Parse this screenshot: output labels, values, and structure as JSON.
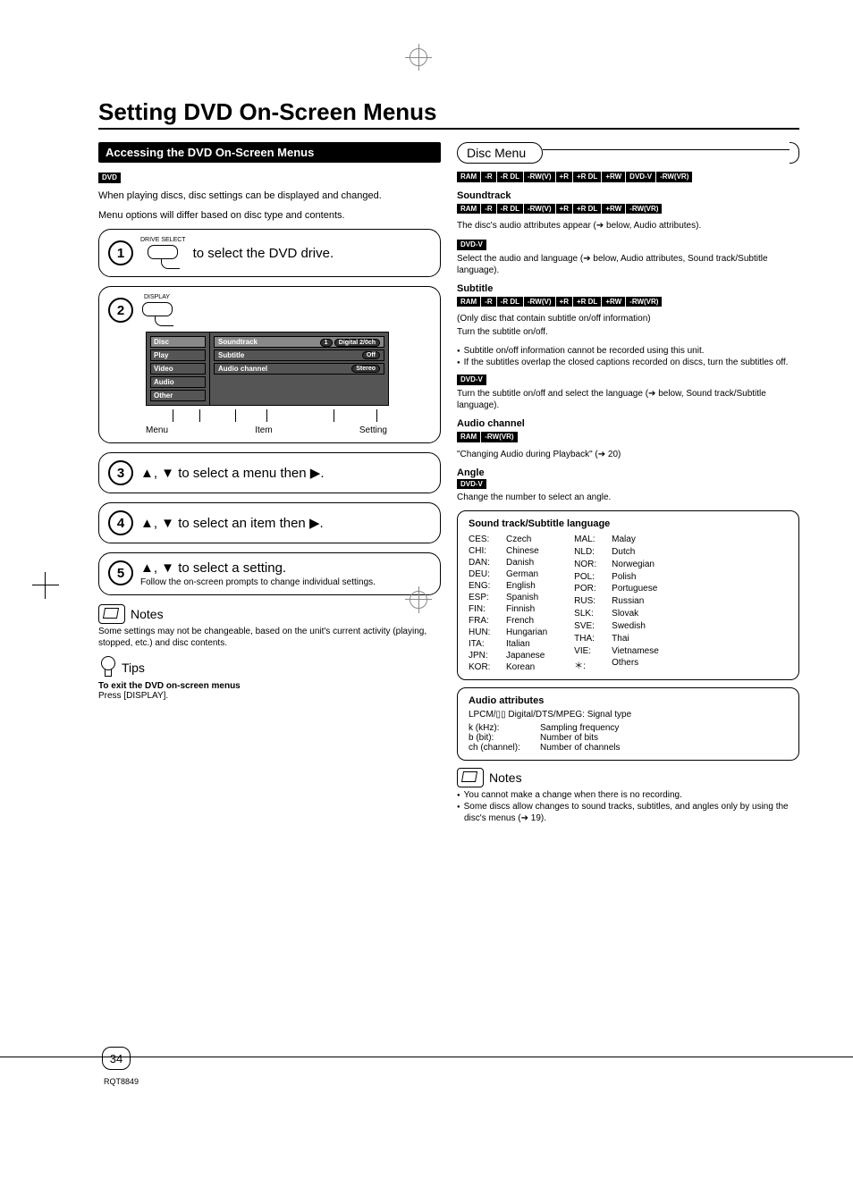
{
  "title": "Setting DVD On-Screen Menus",
  "page_number": "34",
  "doc_code": "RQT8849",
  "left": {
    "heading": "Accessing the DVD On-Screen Menus",
    "dvd_tag": "DVD",
    "intro1": "When playing discs, disc settings can be displayed and changed.",
    "intro2": "Menu options will differ based on disc type and contents.",
    "step1": {
      "btn": "DRIVE SELECT",
      "text": "to select the DVD drive."
    },
    "step2": {
      "btn": "DISPLAY"
    },
    "osd": {
      "tabs": [
        "Disc",
        "Play",
        "Video",
        "Audio",
        "Other"
      ],
      "items": [
        {
          "label": "Soundtrack",
          "val_left": "1",
          "val_right": "Digital 2/0ch"
        },
        {
          "label": "Subtitle",
          "val_right": "Off"
        },
        {
          "label": "Audio channel",
          "val_right": "Stereo"
        }
      ],
      "labels": {
        "menu": "Menu",
        "item": "Item",
        "setting": "Setting"
      }
    },
    "step3": "▲, ▼ to select a menu then ▶.",
    "step4": "▲, ▼ to select an item then ▶.",
    "step5": {
      "main": "▲, ▼ to select a setting.",
      "sub": "Follow the on-screen prompts to change individual settings."
    },
    "notes": {
      "title": "Notes",
      "body": "Some settings may not be changeable, based on the unit's current activity (playing, stopped, etc.) and disc contents."
    },
    "tips": {
      "title": "Tips",
      "bold": "To exit the DVD on-screen menus",
      "body": "Press [DISPLAY]."
    }
  },
  "right": {
    "heading": "Disc Menu",
    "top_tags": [
      "RAM",
      "-R",
      "-R DL",
      "-RW(V)",
      "+R",
      "+R DL",
      "+RW",
      "DVD-V",
      "-RW(VR)"
    ],
    "soundtrack": {
      "title": "Soundtrack",
      "tags": [
        "RAM",
        "-R",
        "-R DL",
        "-RW(V)",
        "+R",
        "+R DL",
        "+RW",
        "-RW(VR)"
      ],
      "line1": "The disc's audio attributes appear (➔ below, Audio attributes).",
      "dvdv": "DVD-V",
      "line2": "Select the audio and language (➔ below, Audio attributes, Sound track/Subtitle language)."
    },
    "subtitle": {
      "title": "Subtitle",
      "tags": [
        "RAM",
        "-R",
        "-R DL",
        "-RW(V)",
        "+R",
        "+R DL",
        "+RW",
        "-RW(VR)"
      ],
      "line1": "(Only disc that contain subtitle on/off information)",
      "line2": "Turn the subtitle on/off.",
      "bullets": [
        "Subtitle on/off information cannot be recorded using this unit.",
        "If the subtitles overlap the closed captions recorded on discs, turn the subtitles off."
      ],
      "dvdv": "DVD-V",
      "line3": "Turn the subtitle on/off and select the language (➔ below, Sound track/Subtitle language)."
    },
    "audio_channel": {
      "title": "Audio channel",
      "tags": [
        "RAM",
        "-RW(VR)"
      ],
      "body": "\"Changing Audio during Playback\" (➔ 20)"
    },
    "angle": {
      "title": "Angle",
      "tag": "DVD-V",
      "body": "Change the number to select an angle."
    },
    "lang_box": {
      "title": "Sound track/Subtitle language",
      "left": [
        [
          "CES:",
          "Czech"
        ],
        [
          "CHI:",
          "Chinese"
        ],
        [
          "DAN:",
          "Danish"
        ],
        [
          "DEU:",
          "German"
        ],
        [
          "ENG:",
          "English"
        ],
        [
          "ESP:",
          "Spanish"
        ],
        [
          "FIN:",
          "Finnish"
        ],
        [
          "FRA:",
          "French"
        ],
        [
          "HUN:",
          "Hungarian"
        ],
        [
          "ITA:",
          "Italian"
        ],
        [
          "JPN:",
          "Japanese"
        ],
        [
          "KOR:",
          "Korean"
        ]
      ],
      "right": [
        [
          "MAL:",
          "Malay"
        ],
        [
          "NLD:",
          "Dutch"
        ],
        [
          "NOR:",
          "Norwegian"
        ],
        [
          "POL:",
          "Polish"
        ],
        [
          "POR:",
          "Portuguese"
        ],
        [
          "RUS:",
          "Russian"
        ],
        [
          "SLK:",
          "Slovak"
        ],
        [
          "SVE:",
          "Swedish"
        ],
        [
          "THA:",
          "Thai"
        ],
        [
          "VIE:",
          "Vietnamese"
        ],
        [
          "＊:",
          "Others"
        ]
      ]
    },
    "attr_box": {
      "title": "Audio attributes",
      "line": "LPCM/▯▯ Digital/DTS/MPEG: Signal type",
      "rows": [
        [
          "k (kHz):",
          "Sampling frequency"
        ],
        [
          "b (bit):",
          "Number of bits"
        ],
        [
          "ch (channel):",
          "Number of channels"
        ]
      ]
    },
    "notes2": {
      "title": "Notes",
      "bullets": [
        "You cannot make a change when there is no recording.",
        "Some discs allow changes to sound tracks, subtitles, and angles only by using the disc's menus (➔ 19)."
      ]
    }
  }
}
